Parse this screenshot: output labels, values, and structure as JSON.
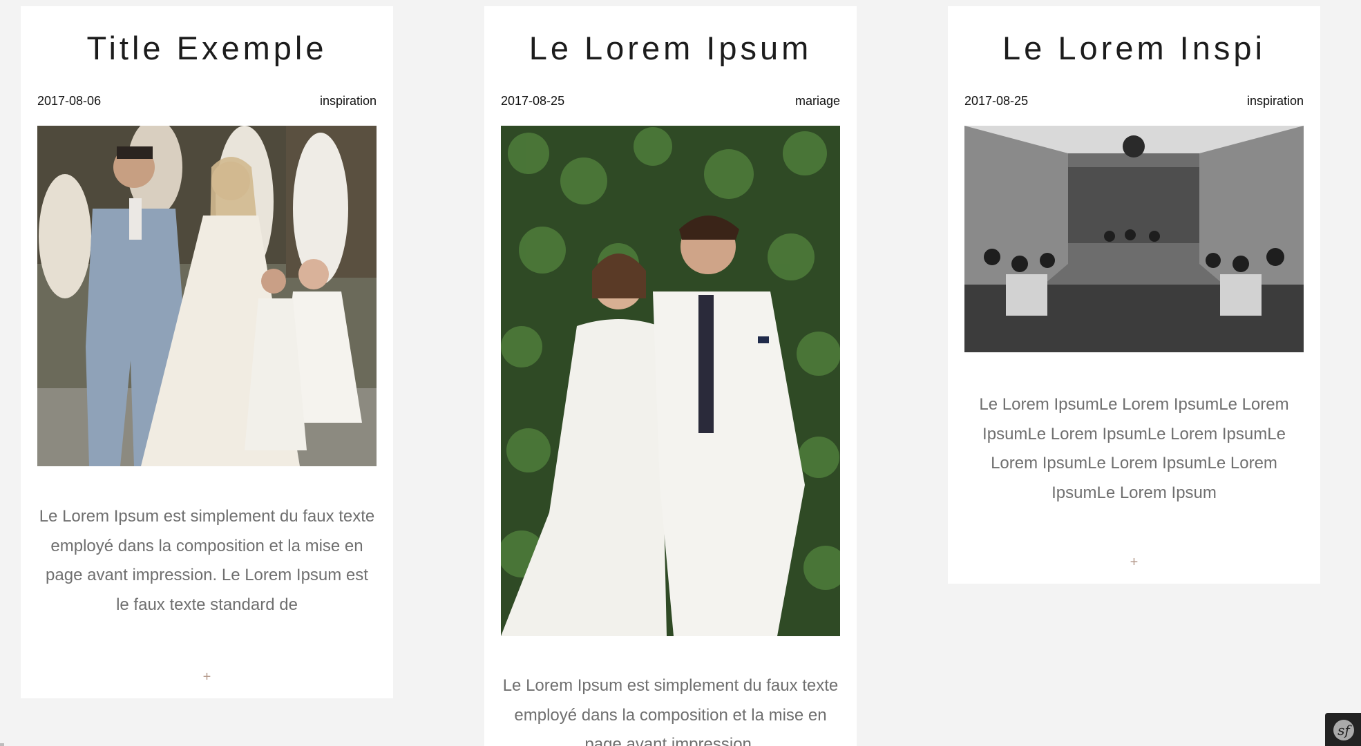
{
  "posts": [
    {
      "title": "Title Exemple",
      "date": "2017-08-06",
      "category": "inspiration",
      "image_alt": "Wedding procession photo",
      "excerpt": "Le Lorem Ipsum est simplement du faux texte employé dans la composition et la mise en page avant impression. Le Lorem Ipsum est le faux texte standard de",
      "more_label": "+"
    },
    {
      "title": "Le Lorem Ipsum",
      "date": "2017-08-25",
      "category": "mariage",
      "image_alt": "Couple portrait in front of ivy wall",
      "excerpt": "Le Lorem Ipsum est simplement du faux texte employé dans la composition et la mise en page avant impression.",
      "more_label": "+"
    },
    {
      "title": "Le Lorem Inspi",
      "date": "2017-08-25",
      "category": "inspiration",
      "image_alt": "Black and white ceremony hall",
      "excerpt": "Le Lorem IpsumLe Lorem IpsumLe Lorem IpsumLe Lorem IpsumLe Lorem IpsumLe Lorem IpsumLe Lorem IpsumLe Lorem IpsumLe Lorem Ipsum",
      "more_label": "+"
    }
  ],
  "toolbar": {
    "logo_glyph": "sf"
  }
}
